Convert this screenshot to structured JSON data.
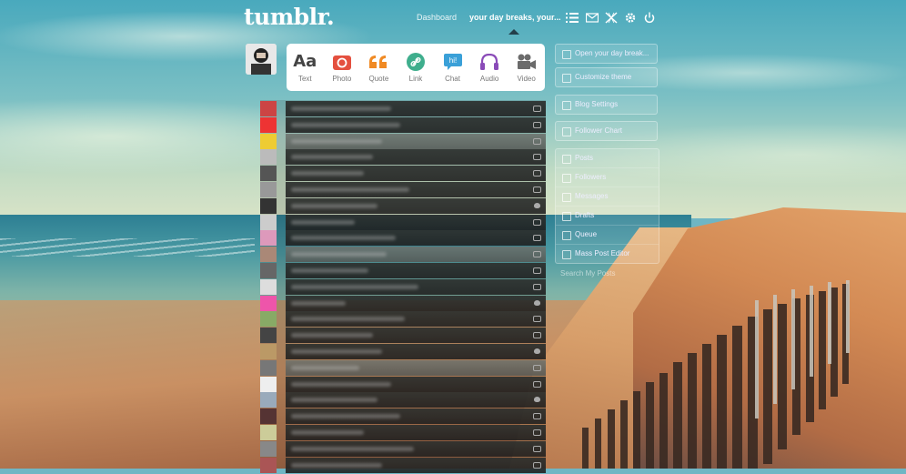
{
  "header": {
    "logo": "tumblr.",
    "dashboard_link": "Dashboard",
    "blog_link": "your day breaks, your...",
    "icons": [
      "list-icon",
      "mail-icon",
      "x-icon",
      "gear-icon",
      "power-icon"
    ]
  },
  "post_types": [
    {
      "label": "Text",
      "icon": "text-icon",
      "color": "#444444"
    },
    {
      "label": "Photo",
      "icon": "camera-icon",
      "color": "#e4503f"
    },
    {
      "label": "Quote",
      "icon": "quote-icon",
      "color": "#f08a24"
    },
    {
      "label": "Link",
      "icon": "link-icon",
      "color": "#3fae8d"
    },
    {
      "label": "Chat",
      "icon": "chat-icon",
      "color": "#3aa0d8"
    },
    {
      "label": "Audio",
      "icon": "headphones-icon",
      "color": "#8a4bb8"
    },
    {
      "label": "Video",
      "icon": "video-camera-icon",
      "color": "#6b6b6b"
    }
  ],
  "sidebar": {
    "open_blog": "Open your day break...",
    "customize_theme": "Customize theme",
    "blog_settings": "Blog Settings",
    "follower_chart": "Follower Chart",
    "list": [
      {
        "label": "Posts"
      },
      {
        "label": "Followers"
      },
      {
        "label": "Messages"
      },
      {
        "label": "Drafts"
      },
      {
        "label": "Queue"
      },
      {
        "label": "Mass Post Editor"
      }
    ],
    "search_placeholder": "Search My Posts"
  },
  "colors": {
    "post_box": "#ffffff",
    "feed_bar": "#2d302e",
    "caret": "#233e4a"
  }
}
